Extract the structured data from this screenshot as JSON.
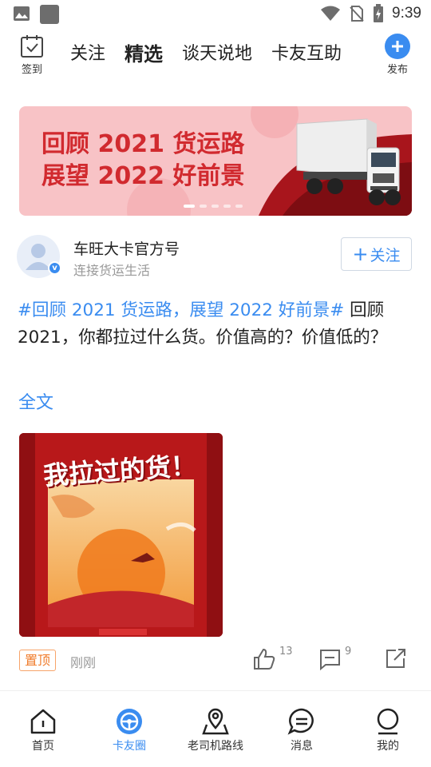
{
  "status_bar": {
    "time": "9:39"
  },
  "top_nav": {
    "checkin_label": "签到",
    "tabs": [
      {
        "label": "关注",
        "active": false
      },
      {
        "label": "精选",
        "active": true
      },
      {
        "label": "谈天说地",
        "active": false
      },
      {
        "label": "卡友互助",
        "active": false
      }
    ],
    "publish_label": "发布"
  },
  "banner": {
    "line1": "回顾 2021 货运路",
    "line2": "展望 2022 好前景",
    "dot_count": 5,
    "active_dot": 0
  },
  "post": {
    "author_name": "车旺大卡官方号",
    "author_subtitle": "连接货运生活",
    "follow_label": "关注",
    "hashtag": "#回顾 2021 货运路，展望 2022 好前景#",
    "body": " 回顾 2021，你都拉过什么货。价值高的？价值低的？",
    "full_text_link": "全文",
    "image_caption": "我拉过的货！",
    "pinned_badge": "置顶",
    "time": "刚刚",
    "like_count": "13",
    "comment_count": "9"
  },
  "bottom_nav": {
    "items": [
      {
        "label": "首页",
        "icon": "home-icon",
        "active": false
      },
      {
        "label": "卡友圈",
        "icon": "steering-wheel-icon",
        "active": true
      },
      {
        "label": "老司机路线",
        "icon": "map-route-icon",
        "active": false
      },
      {
        "label": "消息",
        "icon": "message-icon",
        "active": false
      },
      {
        "label": "我的",
        "icon": "profile-icon",
        "active": false
      }
    ]
  },
  "colors": {
    "accent": "#3a8cf0",
    "banner_text": "#d12a2f",
    "pinned": "#f07b2a"
  }
}
